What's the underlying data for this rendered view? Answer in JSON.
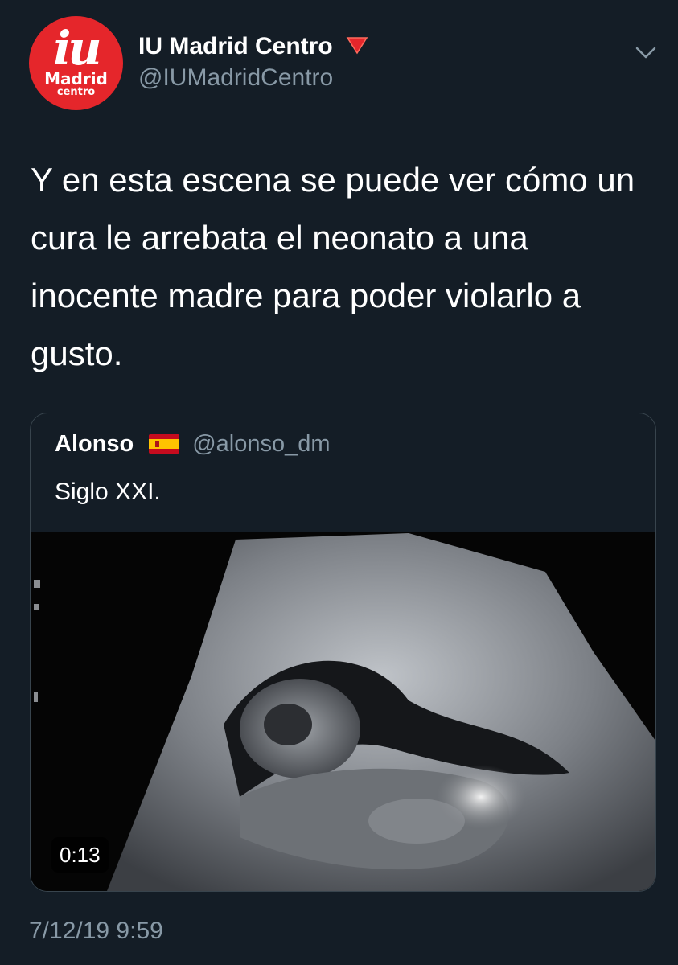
{
  "tweet": {
    "author": {
      "display_name": "IU Madrid Centro",
      "handle": "@IUMadridCentro",
      "avatar": {
        "logo_text": "iu",
        "logo_line1": "Madrid",
        "logo_line2": "centro",
        "bg_color": "#e5262b"
      },
      "badge_icon": "red-down-triangle-icon"
    },
    "menu_icon": "chevron-down-icon",
    "text": "Y en esta escena se puede ver cómo un cura le arrebata el neonato a una inocente madre para poder violarlo a gusto.",
    "timestamp": "7/12/19 9:59"
  },
  "quoted_tweet": {
    "display_name": "Alonso",
    "flag_icon": "spain-flag-icon",
    "handle": "@alonso_dm",
    "text": "Siglo XXI.",
    "video": {
      "description_icon": "ultrasound-video-thumbnail",
      "duration": "0:13"
    }
  },
  "colors": {
    "background": "#141d26",
    "text_primary": "#ffffff",
    "text_secondary": "#8899a6",
    "border": "#38444d",
    "accent_red": "#e5262b"
  }
}
